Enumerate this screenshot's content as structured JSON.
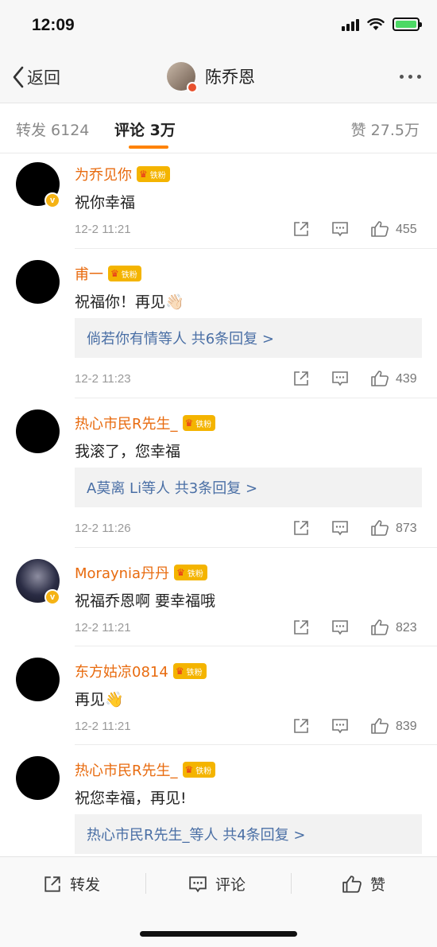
{
  "status": {
    "time": "12:09"
  },
  "nav": {
    "back_label": "返回",
    "title": "陈乔恩"
  },
  "tabs": {
    "repost": "转发 6124",
    "comment": "评论 3万",
    "like": "赞 27.5万"
  },
  "fan_badge_text": "铁粉",
  "comments": [
    {
      "user": "为乔见你",
      "text": "祝你幸福",
      "reply": "",
      "time": "12-2 11:21",
      "likes": "455"
    },
    {
      "user": "甫一",
      "text": "祝福你！再见👋🏻",
      "reply": "倘若你有情等人  共6条回复 >",
      "time": "12-2 11:23",
      "likes": "439"
    },
    {
      "user": "热心市民R先生_",
      "text": "我滚了，您幸福",
      "reply": "A莫离 Li等人  共3条回复 >",
      "time": "12-2 11:26",
      "likes": "873"
    },
    {
      "user": "Moraynia丹丹",
      "text": "祝福乔恩啊  要幸福哦",
      "reply": "",
      "time": "12-2 11:21",
      "likes": "823"
    },
    {
      "user": "东方姑凉0814",
      "text": "再见👋",
      "reply": "",
      "time": "12-2 11:21",
      "likes": "839"
    },
    {
      "user": "热心市民R先生_",
      "text": "祝您幸福，再见!",
      "reply": "热心市民R先生_等人  共4条回复 >",
      "time": "",
      "likes": ""
    }
  ],
  "bottom": {
    "repost": "转发",
    "comment": "评论",
    "like": "赞"
  },
  "colors": {
    "accent": "#ff8200",
    "username": "#e86b0f",
    "link": "#4a6fa5"
  }
}
